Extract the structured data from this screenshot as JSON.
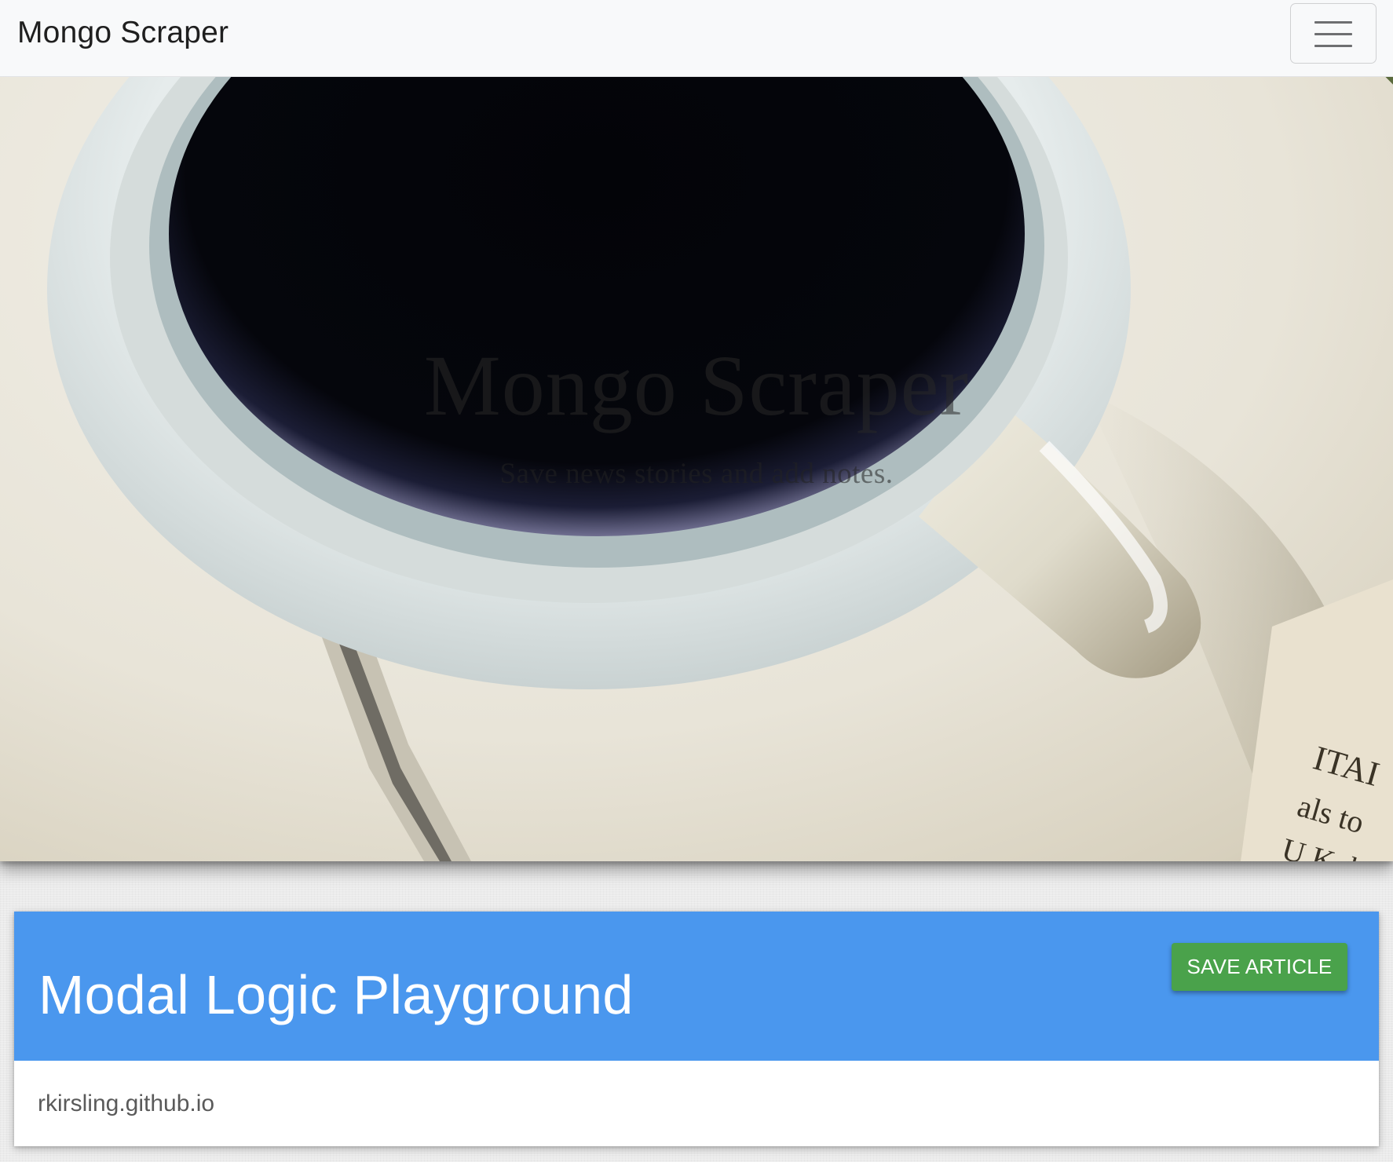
{
  "navbar": {
    "brand": "Mongo Scraper",
    "toggler_icon": "hamburger-menu-icon"
  },
  "hero": {
    "title": "Mongo Scraper",
    "subtitle": "Save news stories and add notes."
  },
  "articles": [
    {
      "title": "Modal Logic Playground",
      "save_label": "SAVE ARTICLE",
      "link_text": "rkirsling.github.io"
    }
  ],
  "colors": {
    "navbar_bg": "#f8f9fa",
    "card_header_bg": "#4a97ee",
    "save_button_bg": "#4aa24b",
    "page_bg": "#ebebeb"
  }
}
